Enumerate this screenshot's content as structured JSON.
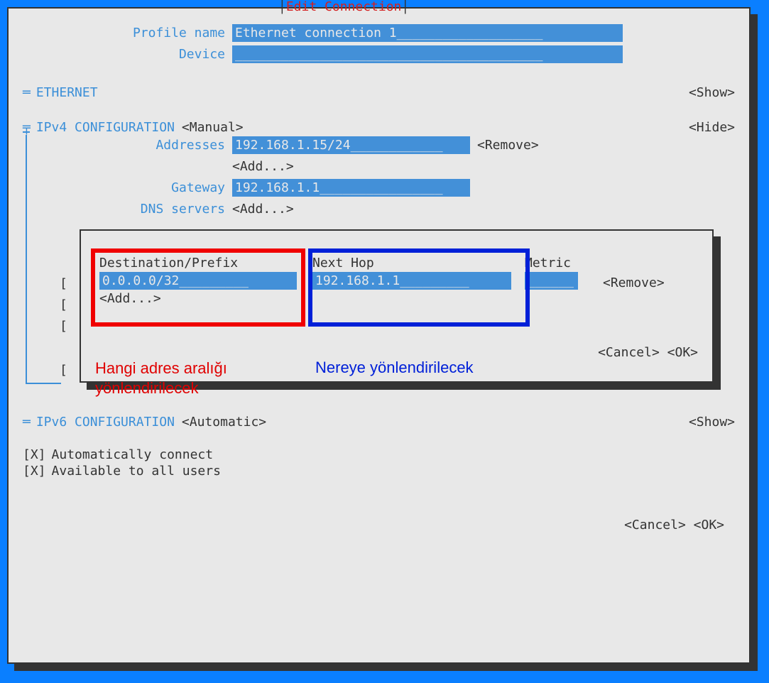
{
  "window": {
    "title": "Edit Connection"
  },
  "profile": {
    "name_label": "Profile name",
    "name_value": "Ethernet connection 1",
    "device_label": "Device",
    "device_value": ""
  },
  "ethernet": {
    "expander": "═",
    "label": "ETHERNET",
    "toggle": "<Show>"
  },
  "ipv4": {
    "expander": "╤",
    "label": "IPv4 CONFIGURATION",
    "mode": "<Manual>",
    "toggle": "<Hide>",
    "addresses_label": "Addresses",
    "addresses_value": "192.168.1.15/24",
    "addresses_remove": "<Remove>",
    "add_link": "<Add...>",
    "gateway_label": "Gateway",
    "gateway_value": "192.168.1.1",
    "dns_label": "DNS servers",
    "dns_add": "<Add...>"
  },
  "routes_dialog": {
    "dest_header": "Destination/Prefix",
    "nexthop_header": "Next Hop",
    "metric_header": "Metric",
    "dest_value": "0.0.0.0/32",
    "nexthop_value": "192.168.1.1",
    "metric_value": "",
    "remove": "<Remove>",
    "add": "<Add...>",
    "cancel": "<Cancel>",
    "ok": "<OK>",
    "brackets": [
      "[",
      "[",
      "[",
      "[",
      ""
    ],
    "annotation_red": "Hangi adres aralığı yönlendirilecek",
    "annotation_blue": "Nereye yönlendirilecek"
  },
  "ipv6": {
    "expander": "═",
    "label": "IPv6 CONFIGURATION",
    "mode": "<Automatic>",
    "toggle": "<Show>"
  },
  "checkboxes": {
    "auto_connect_marker": "[X]",
    "auto_connect_label": "Automatically connect",
    "all_users_marker": "[X]",
    "all_users_label": "Available to all users"
  },
  "footer": {
    "cancel": "<Cancel>",
    "ok": "<OK>"
  }
}
